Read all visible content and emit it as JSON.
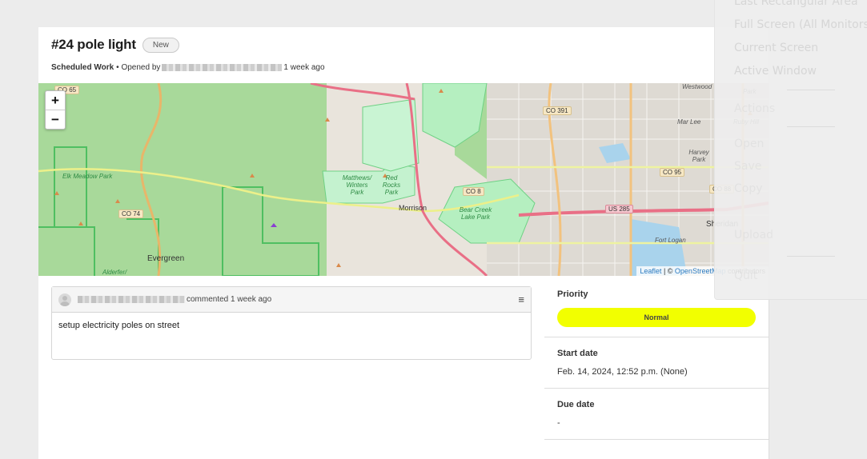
{
  "issue": {
    "title": "#24 pole light",
    "status_badge": "New",
    "category": "Scheduled Work",
    "opened_prefix": "• Opened by",
    "opened_time": "1 week ago"
  },
  "map": {
    "zoom_in": "+",
    "zoom_out": "−",
    "attribution": {
      "leaflet": "Leaflet",
      "separator": " | © ",
      "osm": "OpenStreetMap",
      "suffix": " contributors"
    },
    "labels": {
      "elk_meadow": "Elk Meadow Park",
      "matthews": "Matthews/ Winters Park",
      "red_rocks": "Red Rocks Park",
      "bear_creek": "Bear Creek Lake Park",
      "evergreen": "Evergreen",
      "morrison": "Morrison",
      "sheridan": "Sheridan",
      "fort_logan": "Fort Logan",
      "harvey_park": "Harvey Park",
      "mar_lee": "Mar Lee",
      "ruby_hill": "Ruby Hill",
      "westwood": "Westwood",
      "alderfer": "Alderfer/",
      "park_top": "Park"
    },
    "shields": {
      "co65": "CO 65",
      "co74": "CO 74",
      "co8": "CO 8",
      "co391": "CO 391",
      "co95": "CO 95",
      "co88": "CO 88",
      "us285": "US 285"
    }
  },
  "comment": {
    "action": "commented 1 week ago",
    "body": "setup electricity poles on street",
    "menu_icon": "hamburger-menu-icon"
  },
  "details": {
    "priority_label": "Priority",
    "priority_value": "Normal",
    "priority_color": "#f2ff00",
    "start_label": "Start date",
    "start_value": "Feb. 14, 2024, 12:52 p.m. (None)",
    "due_label": "Due date",
    "due_value": "-"
  },
  "screenshot_menu": {
    "items": [
      "Last Rectangular Area",
      "Full Screen (All Monitors)",
      "Current Screen",
      "Active Window",
      "Actions",
      "Open",
      "Save",
      "Copy",
      "Upload",
      "Quit"
    ]
  }
}
